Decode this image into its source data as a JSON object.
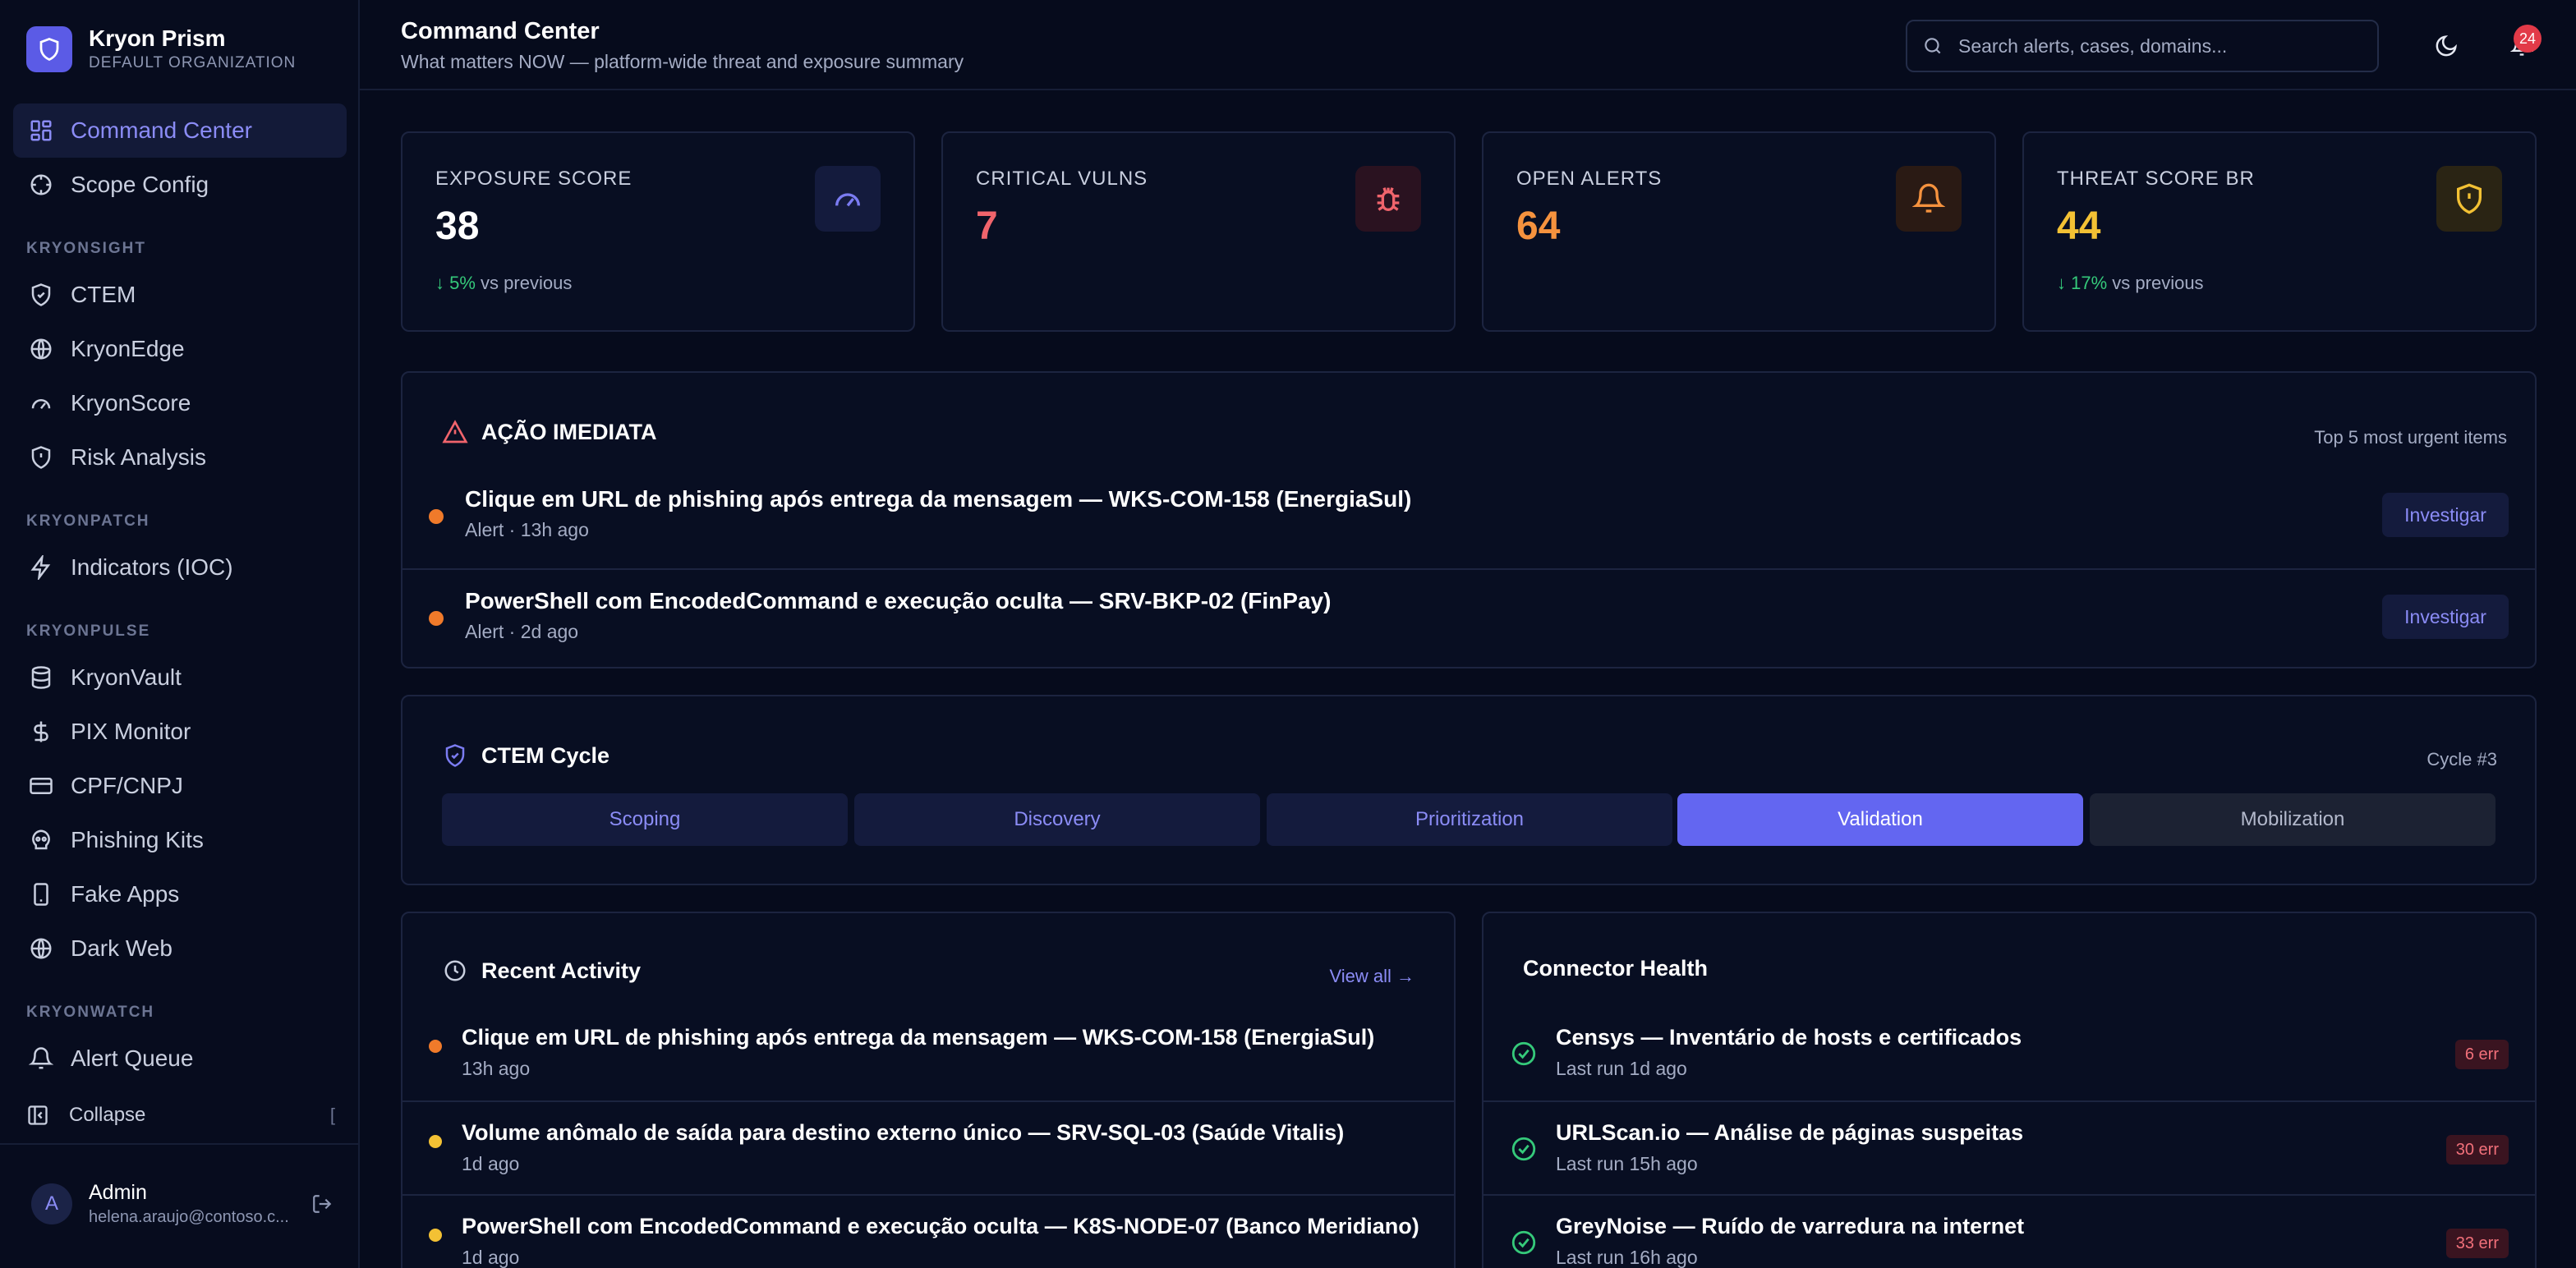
{
  "brand": {
    "name": "Kryon Prism",
    "org": "DEFAULT ORGANIZATION"
  },
  "sidebar": {
    "items_top": [
      {
        "label": "Command Center",
        "icon": "grid-icon",
        "active": true
      },
      {
        "label": "Scope Config",
        "icon": "target-icon"
      }
    ],
    "sections": [
      {
        "label": "KRYONSIGHT",
        "items": [
          {
            "label": "CTEM",
            "icon": "shield-check-icon"
          },
          {
            "label": "KryonEdge",
            "icon": "globe-icon"
          },
          {
            "label": "KryonScore",
            "icon": "gauge-icon"
          },
          {
            "label": "Risk Analysis",
            "icon": "shield-alert-icon"
          }
        ]
      },
      {
        "label": "KRYONPATCH",
        "items": [
          {
            "label": "Indicators (IOC)",
            "icon": "zap-icon"
          }
        ]
      },
      {
        "label": "KRYONPULSE",
        "items": [
          {
            "label": "KryonVault",
            "icon": "database-icon"
          },
          {
            "label": "PIX Monitor",
            "icon": "dollar-icon"
          },
          {
            "label": "CPF/CNPJ",
            "icon": "card-icon"
          },
          {
            "label": "Phishing Kits",
            "icon": "skull-icon"
          },
          {
            "label": "Fake Apps",
            "icon": "smartphone-icon"
          },
          {
            "label": "Dark Web",
            "icon": "globe-icon"
          }
        ]
      },
      {
        "label": "KRYONWATCH",
        "items": [
          {
            "label": "Alert Queue",
            "icon": "bell-icon"
          }
        ]
      }
    ],
    "collapse_label": "Collapse",
    "collapse_bracket": "[",
    "user": {
      "initial": "A",
      "name": "Admin",
      "email": "helena.araujo@contoso.c..."
    }
  },
  "header": {
    "title": "Command Center",
    "subtitle": "What matters NOW — platform-wide threat and exposure summary",
    "search_placeholder": "Search alerts, cases, domains...",
    "notification_count": "24"
  },
  "kpis": [
    {
      "label": "EXPOSURE SCORE",
      "value": "38",
      "delta": "↓ 5%",
      "delta_suffix": "vs previous",
      "value_color": "#ffffff",
      "icon": "gauge-icon"
    },
    {
      "label": "CRITICAL VULNS",
      "value": "7",
      "value_color": "#f0646c",
      "icon": "bug-icon"
    },
    {
      "label": "OPEN ALERTS",
      "value": "64",
      "value_color": "#f5923e",
      "icon": "bell-icon"
    },
    {
      "label": "THREAT SCORE BR",
      "value": "44",
      "delta": "↓ 17%",
      "delta_suffix": "vs previous",
      "value_color": "#f3c134",
      "icon": "shield-alert-icon"
    }
  ],
  "urgent": {
    "title": "AÇÃO IMEDIATA",
    "subtitle": "Top 5 most urgent items",
    "items": [
      {
        "title": "Clique em URL de phishing após entrega da mensagem — WKS-COM-158 (EnergiaSul)",
        "meta": "Alert  ·  13h ago",
        "action": "Investigar"
      },
      {
        "title": "PowerShell com EncodedCommand e execução oculta — SRV-BKP-02 (FinPay)",
        "meta": "Alert  ·  2d ago",
        "action": "Investigar"
      }
    ]
  },
  "ctem": {
    "title": "CTEM Cycle",
    "cycle": "Cycle #3",
    "phases": [
      "Scoping",
      "Discovery",
      "Prioritization",
      "Validation",
      "Mobilization"
    ],
    "active_phase": "Validation"
  },
  "activity": {
    "title": "Recent Activity",
    "view_all": "View all →",
    "items": [
      {
        "title": "Clique em URL de phishing após entrega da mensagem — WKS-COM-158 (EnergiaSul)",
        "time": "13h ago",
        "color": "#f07a2a"
      },
      {
        "title": "Volume anômalo de saída para destino externo único — SRV-SQL-03 (Saúde Vitalis)",
        "time": "1d ago",
        "color": "#f3c134"
      },
      {
        "title": "PowerShell com EncodedCommand e execução oculta — K8S-NODE-07 (Banco Meridiano)",
        "time": "1d ago",
        "color": "#f3c134"
      }
    ]
  },
  "connectors": {
    "title": "Connector Health",
    "items": [
      {
        "title": "Censys — Inventário de hosts e certificados",
        "time": "Last run 1d ago",
        "errors": "6 err"
      },
      {
        "title": "URLScan.io — Análise de páginas suspeitas",
        "time": "Last run 15h ago",
        "errors": "30 err"
      },
      {
        "title": "GreyNoise — Ruído de varredura na internet",
        "time": "Last run 16h ago",
        "errors": "33 err"
      }
    ]
  }
}
